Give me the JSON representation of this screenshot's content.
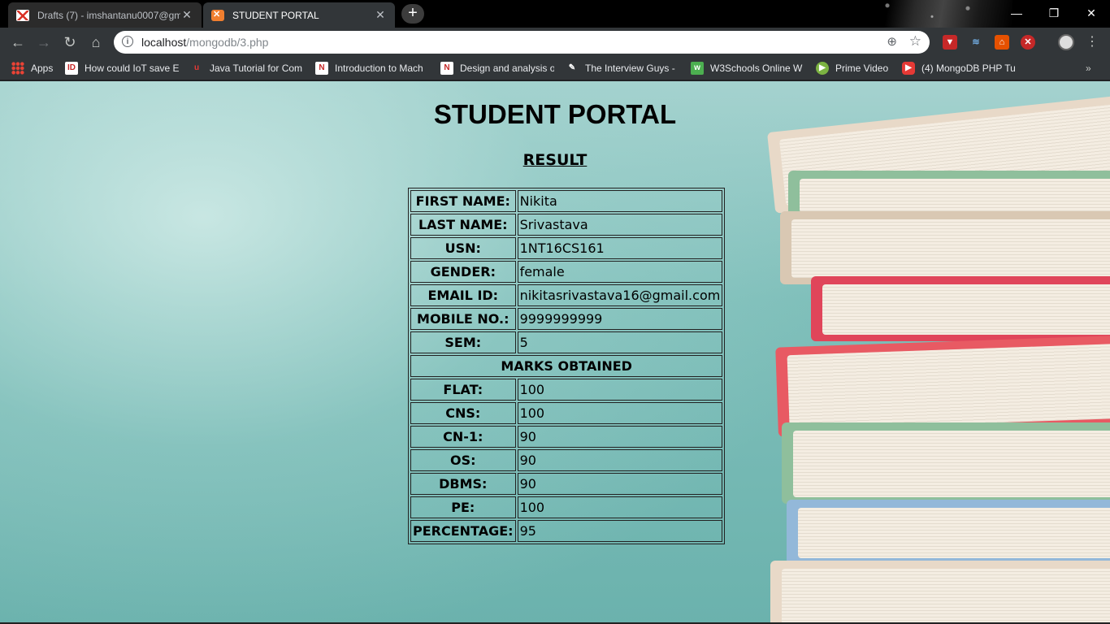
{
  "browser": {
    "tabs": [
      {
        "title": "Drafts (7) - imshantanu0007@gm",
        "icon": "gmail-icon",
        "active": false
      },
      {
        "title": "STUDENT PORTAL",
        "icon": "xampp-icon",
        "active": true
      }
    ],
    "address": {
      "host": "localhost",
      "path": "/mongodb/3.php"
    },
    "bookmarks": [
      {
        "label": "Apps",
        "icon": "apps-grid-icon"
      },
      {
        "label": "How could IoT save E",
        "icon": "id-icon"
      },
      {
        "label": "Java Tutorial for Com",
        "icon": "udemy-icon"
      },
      {
        "label": "Introduction to Mach",
        "icon": "n-icon"
      },
      {
        "label": "Design and analysis o",
        "icon": "n-icon"
      },
      {
        "label": "The Interview Guys -",
        "icon": "interview-guys-icon"
      },
      {
        "label": "W3Schools Online W",
        "icon": "w3schools-icon"
      },
      {
        "label": "Prime Video",
        "icon": "play-icon"
      },
      {
        "label": "(4) MongoDB PHP Tu",
        "icon": "youtube-icon"
      }
    ]
  },
  "page": {
    "title": "STUDENT PORTAL",
    "subtitle": "RESULT",
    "details": [
      {
        "label": "FIRST NAME:",
        "value": "Nikita"
      },
      {
        "label": "LAST NAME:",
        "value": "Srivastava"
      },
      {
        "label": "USN:",
        "value": "1NT16CS161"
      },
      {
        "label": "GENDER:",
        "value": "female"
      },
      {
        "label": "EMAIL ID:",
        "value": "nikitasrivastava16@gmail.com"
      },
      {
        "label": "MOBILE NO.:",
        "value": "9999999999"
      },
      {
        "label": "SEM:",
        "value": "5"
      }
    ],
    "marks_header": "MARKS OBTAINED",
    "marks": [
      {
        "label": "FLAT:",
        "value": "100"
      },
      {
        "label": "CNS:",
        "value": "100"
      },
      {
        "label": "CN-1:",
        "value": "90"
      },
      {
        "label": "OS:",
        "value": "90"
      },
      {
        "label": "DBMS:",
        "value": "90"
      },
      {
        "label": "PE:",
        "value": "100"
      },
      {
        "label": "PERCENTAGE:",
        "value": "95"
      }
    ]
  }
}
